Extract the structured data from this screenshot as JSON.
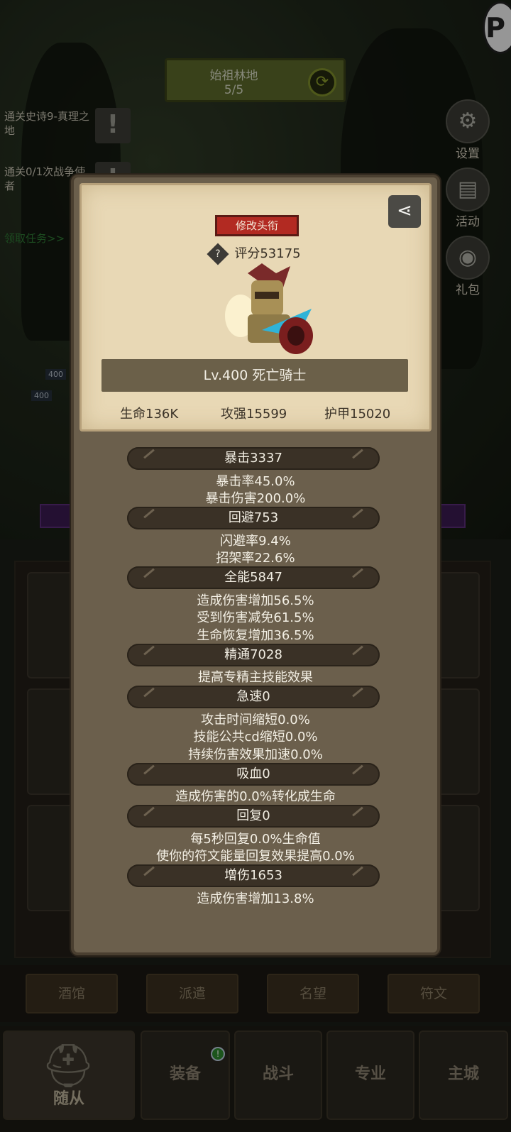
{
  "stage": {
    "name": "始祖林地",
    "progress": "5/5"
  },
  "quests": [
    {
      "text": "通关史诗9-真理之地"
    },
    {
      "text": "通关0/1次战争使者"
    }
  ],
  "quest_link": "领取任务>>",
  "side_buttons": [
    {
      "label": "设置"
    },
    {
      "label": "活动"
    },
    {
      "label": "礼包"
    }
  ],
  "mini_tags": [
    "400",
    "400"
  ],
  "popup": {
    "title_button": "修改头衔",
    "score": "评分53175",
    "level_name": "Lv.400 死亡骑士",
    "hp": "生命136K",
    "attack": "攻强15599",
    "armor": "护甲15020",
    "stats": [
      {
        "head": "暴击3337",
        "subs": [
          "暴击率45.0%",
          "暴击伤害200.0%"
        ]
      },
      {
        "head": "回避753",
        "subs": [
          "闪避率9.4%",
          "招架率22.6%"
        ]
      },
      {
        "head": "全能5847",
        "subs": [
          "造成伤害增加56.5%",
          "受到伤害减免61.5%",
          "生命恢复增加36.5%"
        ]
      },
      {
        "head": "精通7028",
        "subs": [
          "提高专精主技能效果"
        ]
      },
      {
        "head": "急速0",
        "subs": [
          "攻击时间缩短0.0%",
          "技能公共cd缩短0.0%",
          "持续伤害效果加速0.0%"
        ]
      },
      {
        "head": "吸血0",
        "subs": [
          "造成伤害的0.0%转化成生命"
        ]
      },
      {
        "head": "回复0",
        "subs": [
          "每5秒回复0.0%生命值",
          "使你的符文能量回复效果提高0.0%"
        ]
      },
      {
        "head": "增伤1653",
        "subs": [
          "造成伤害增加13.8%"
        ]
      }
    ]
  },
  "sub_tabs": [
    "酒馆",
    "派遣",
    "名望",
    "符文"
  ],
  "nav": [
    {
      "label": "随从"
    },
    {
      "label": "装备"
    },
    {
      "label": "战斗"
    },
    {
      "label": "专业"
    },
    {
      "label": "主城"
    }
  ],
  "colors": {
    "title_button": "#b22a22",
    "stage_bg": "#5c6a2a",
    "popup_bg": "#6b5f4c",
    "parchment": "#e8d8b5",
    "quest_link": "#2e7a34"
  }
}
